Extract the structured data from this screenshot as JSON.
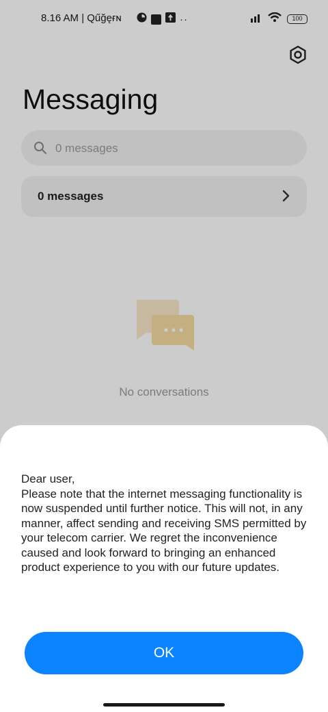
{
  "status_bar": {
    "time": "8.16 AM | Qűğęғɴ",
    "battery": "100"
  },
  "header": {
    "title": "Messaging",
    "settings_icon": "settings-gear-icon"
  },
  "search": {
    "placeholder": "0 messages"
  },
  "messages_row": {
    "label": "0 messages"
  },
  "empty_state": {
    "text": "No conversations"
  },
  "dialog": {
    "message": "Dear user,\nPlease note that the internet messaging functionality is now suspended until further notice. This will not, in any manner, affect sending and receiving SMS permitted by your telecom carrier. We regret the inconvenience caused and look forward to bringing an enhanced product experience to you with our future updates.",
    "ok_label": "OK"
  },
  "colors": {
    "accent": "#0d84ff",
    "scrim": "rgba(0,0,0,0.2)",
    "empty_illustration": "#f5dba0"
  }
}
